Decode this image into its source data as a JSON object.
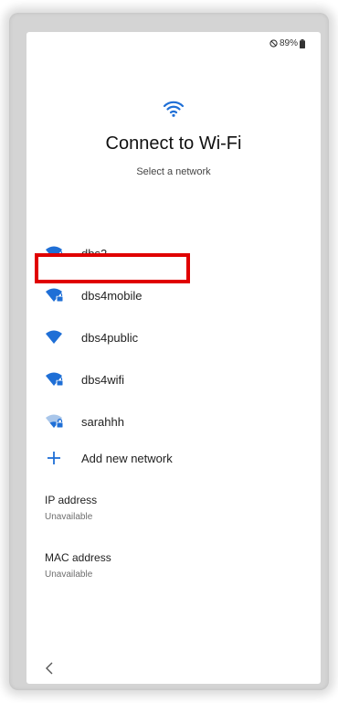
{
  "status_bar": {
    "battery": "89%",
    "icons": [
      "do-not-disturb-icon",
      "battery-icon"
    ]
  },
  "header": {
    "icon": "wifi-icon",
    "title": "Connect to Wi-Fi",
    "subtitle": "Select a network"
  },
  "networks": [
    {
      "ssid": "dbs2",
      "secured": true,
      "signal": "full"
    },
    {
      "ssid": "dbs4mobile",
      "secured": true,
      "signal": "full"
    },
    {
      "ssid": "dbs4public",
      "secured": false,
      "signal": "full"
    },
    {
      "ssid": "dbs4wifi",
      "secured": true,
      "signal": "full"
    },
    {
      "ssid": "sarahhh",
      "secured": true,
      "signal": "weak"
    }
  ],
  "add_network": {
    "icon": "plus-icon",
    "label": "Add new network"
  },
  "ip_address": {
    "label": "IP address",
    "value": "Unavailable"
  },
  "mac_address": {
    "label": "MAC address",
    "value": "Unavailable"
  },
  "navigation": {
    "back_icon": "chevron-left-icon"
  },
  "colors": {
    "accent": "#1f6fd6",
    "weak_signal": "#a9c6ea",
    "highlight": "#e00000"
  }
}
